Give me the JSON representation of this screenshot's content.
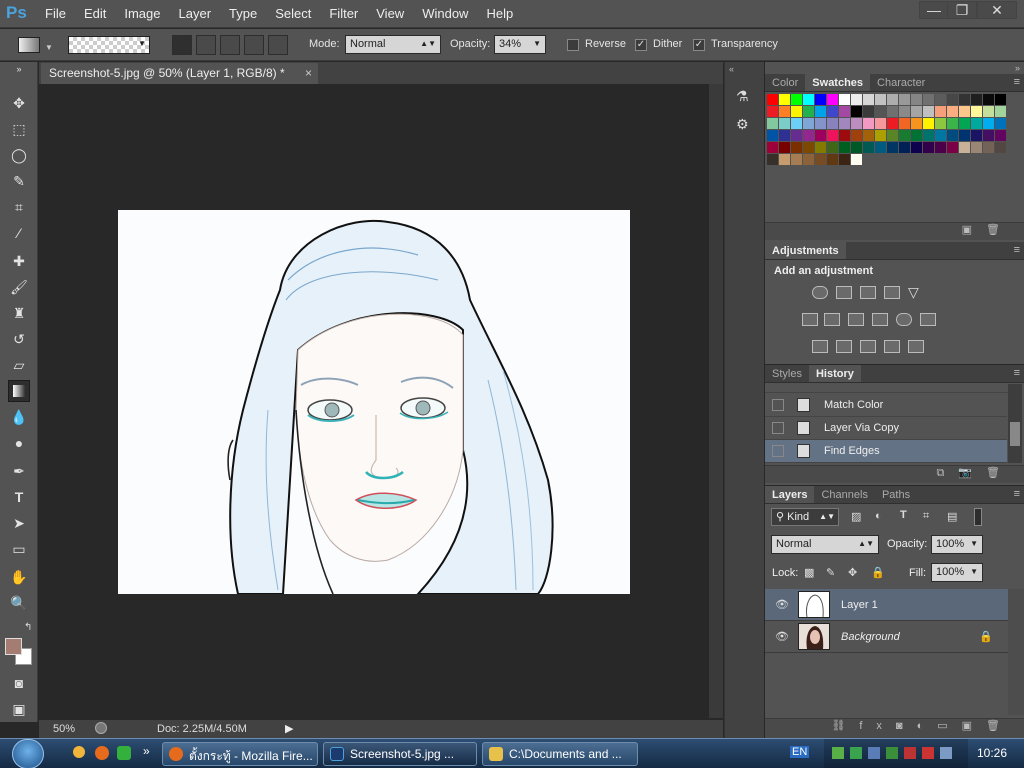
{
  "app": {
    "logo": "Ps"
  },
  "menu": [
    "File",
    "Edit",
    "Image",
    "Layer",
    "Type",
    "Select",
    "Filter",
    "View",
    "Window",
    "Help"
  ],
  "window_controls": {
    "minimize": "—",
    "restore": "❐",
    "close": "✕"
  },
  "options": {
    "mode_label": "Mode:",
    "mode_value": "Normal",
    "opacity_label": "Opacity:",
    "opacity_value": "34%",
    "reverse_label": "Reverse",
    "dither_label": "Dither",
    "transparency_label": "Transparency",
    "reverse_checked": false,
    "dither_checked": true,
    "transparency_checked": true
  },
  "document": {
    "tab_title": "Screenshot-5.jpg @ 50% (Layer 1, RGB/8) *",
    "tab_close": "×"
  },
  "status": {
    "zoom": "50%",
    "doc_info": "Doc: 2.25M/4.50M"
  },
  "swatch_panel": {
    "tabs": [
      "Color",
      "Swatches",
      "Character"
    ],
    "active_tab": "Swatches"
  },
  "adjustments": {
    "tab": "Adjustments",
    "subtitle": "Add an adjustment"
  },
  "history_panel": {
    "tabs": [
      "Styles",
      "History"
    ],
    "active_tab": "History",
    "items": [
      {
        "label": "Match Color",
        "selected": false
      },
      {
        "label": "Layer Via Copy",
        "selected": false
      },
      {
        "label": "Find Edges",
        "selected": true
      }
    ]
  },
  "layers_panel": {
    "tabs": [
      "Layers",
      "Channels",
      "Paths"
    ],
    "active_tab": "Layers",
    "kind_label": "Kind",
    "blend_mode": "Normal",
    "opacity_label": "Opacity:",
    "opacity_value": "100%",
    "lock_label": "Lock:",
    "fill_label": "Fill:",
    "fill_value": "100%",
    "layers": [
      {
        "name": "Layer 1",
        "selected": true,
        "visible": true,
        "locked": false
      },
      {
        "name": "Background",
        "selected": false,
        "visible": true,
        "locked": true
      }
    ]
  },
  "taskbar": {
    "items": [
      {
        "label": "ตั้งกระทู้ - Mozilla Fire...",
        "icon_color": "#e66b1c",
        "active": false
      },
      {
        "label": "Screenshot-5.jpg ...",
        "icon_color": "#1b3b6f",
        "active": true
      },
      {
        "label": "C:\\Documents and ...",
        "icon_color": "#e7c14a",
        "active": false
      }
    ],
    "lang": "EN",
    "clock": "10:26"
  },
  "colors": {
    "foreground": "#a57c72",
    "background": "#ffffff",
    "accent": "#4aa3df"
  }
}
